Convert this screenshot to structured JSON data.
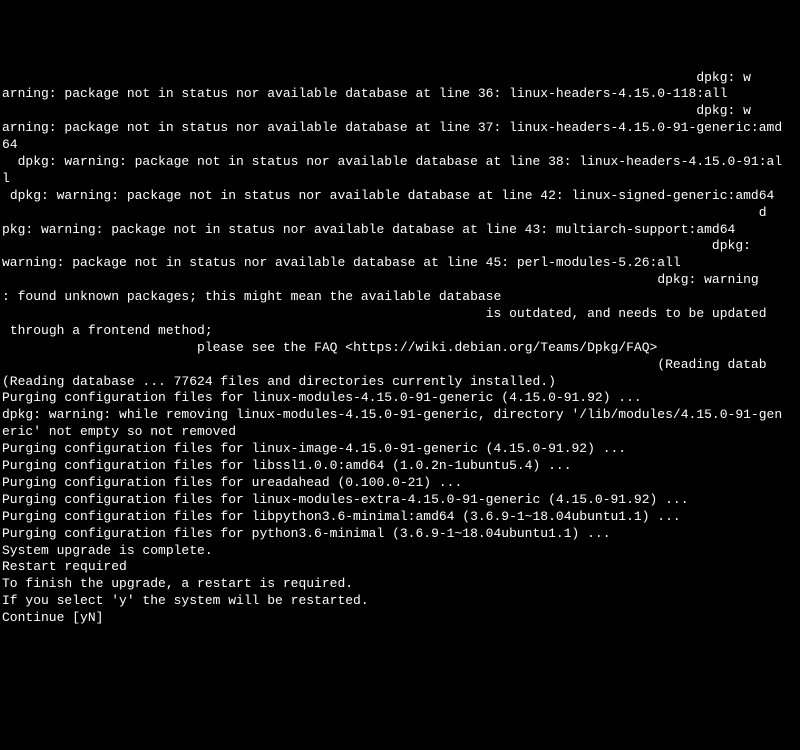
{
  "lines": [
    "                                                                                         dpkg: w",
    "arning: package not in status nor available database at line 36: linux-headers-4.15.0-118:all",
    "                                                                                         dpkg: w",
    "arning: package not in status nor available database at line 37: linux-headers-4.15.0-91-generic:amd",
    "64",
    "  dpkg: warning: package not in status nor available database at line 38: linux-headers-4.15.0-91:al",
    "l",
    " dpkg: warning: package not in status nor available database at line 42: linux-signed-generic:amd64",
    "                                                                                                 d",
    "pkg: warning: package not in status nor available database at line 43: multiarch-support:amd64",
    "                                                                                           dpkg:",
    "warning: package not in status nor available database at line 45: perl-modules-5.26:all",
    "                                                                                    dpkg: warning",
    ": found unknown packages; this might mean the available database",
    "                                                              is outdated, and needs to be updated",
    " through a frontend method;",
    "                         please see the FAQ <https://wiki.debian.org/Teams/Dpkg/FAQ>",
    "                                                                                    (Reading datab",
    "(Reading database ... 77624 files and directories currently installed.)",
    "Purging configuration files for linux-modules-4.15.0-91-generic (4.15.0-91.92) ...",
    "dpkg: warning: while removing linux-modules-4.15.0-91-generic, directory '/lib/modules/4.15.0-91-gen",
    "eric' not empty so not removed",
    "Purging configuration files for linux-image-4.15.0-91-generic (4.15.0-91.92) ...",
    "Purging configuration files for libssl1.0.0:amd64 (1.0.2n-1ubuntu5.4) ...",
    "Purging configuration files for ureadahead (0.100.0-21) ...",
    "Purging configuration files for linux-modules-extra-4.15.0-91-generic (4.15.0-91.92) ...",
    "Purging configuration files for libpython3.6-minimal:amd64 (3.6.9-1~18.04ubuntu1.1) ...",
    "Purging configuration files for python3.6-minimal (3.6.9-1~18.04ubuntu1.1) ...",
    "",
    "System upgrade is complete.",
    "",
    "Restart required",
    "",
    "To finish the upgrade, a restart is required.",
    "If you select 'y' the system will be restarted.",
    "",
    "Continue [yN]"
  ]
}
